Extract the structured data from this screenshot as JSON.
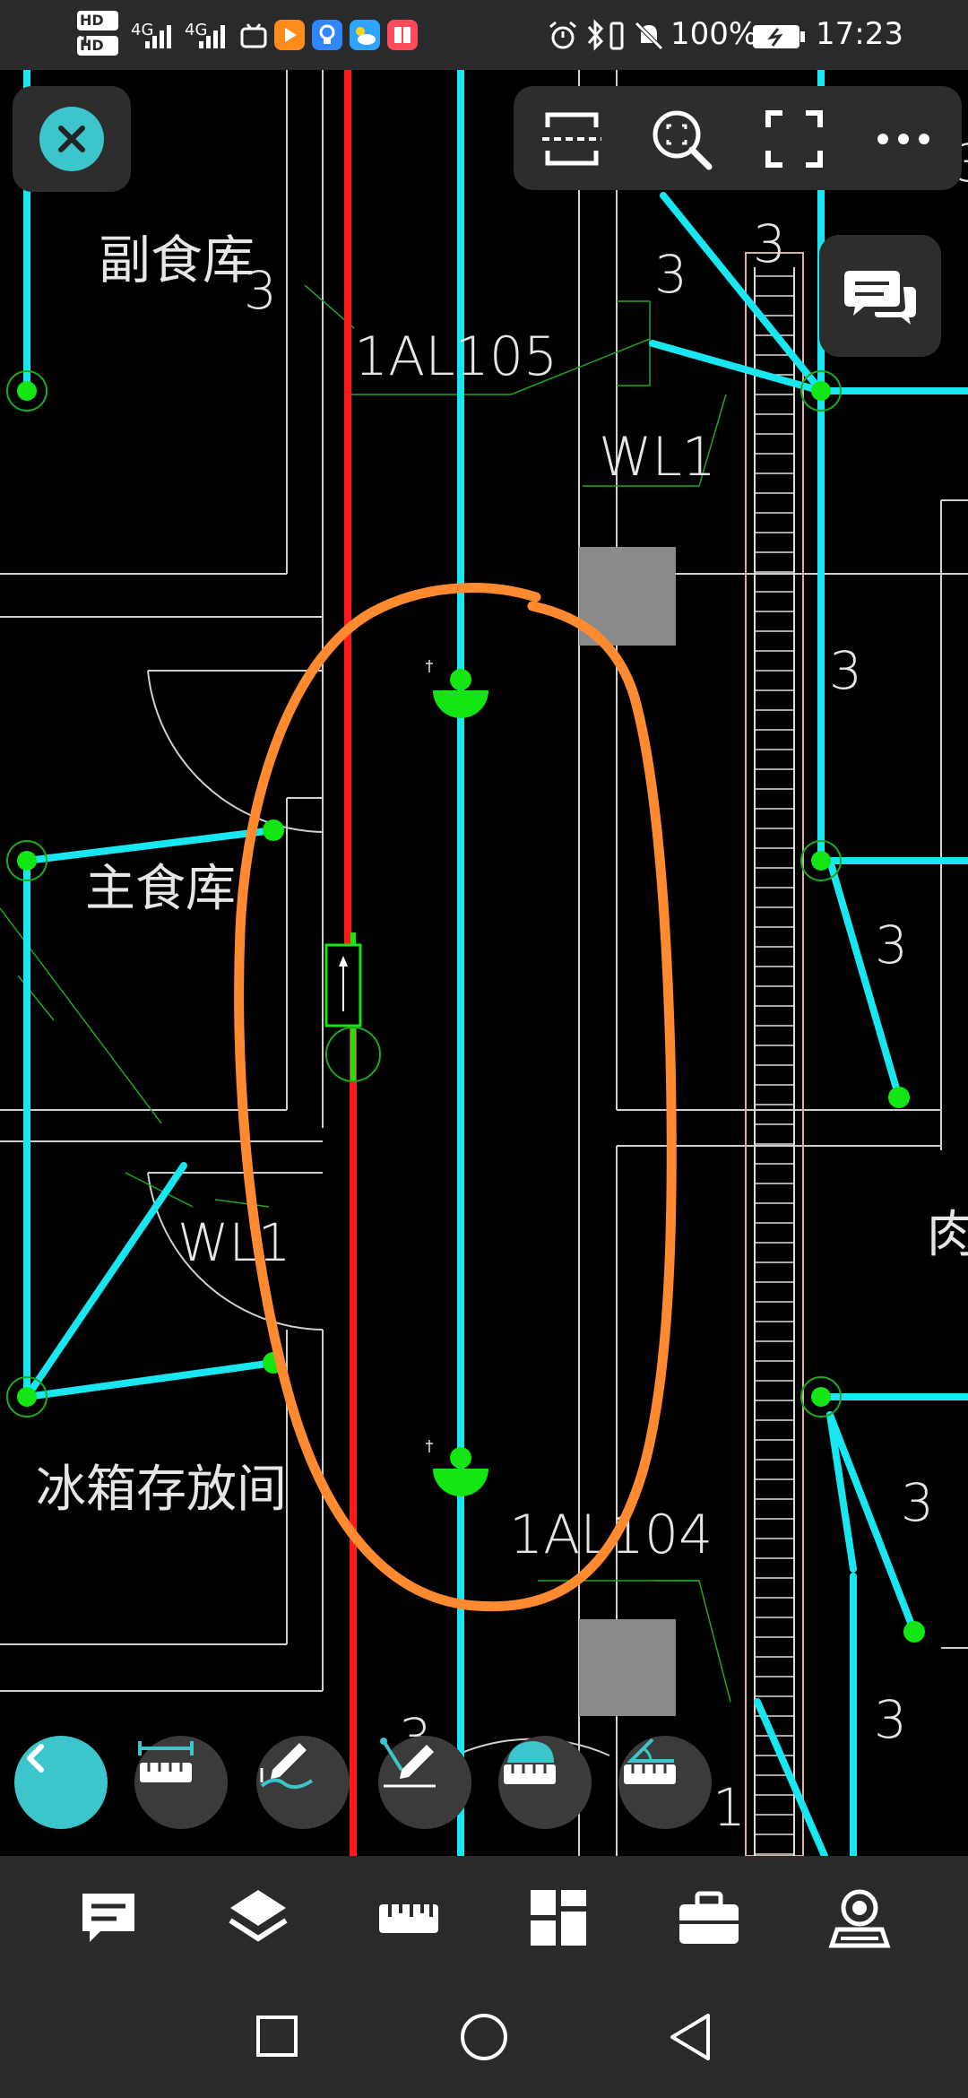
{
  "status_bar": {
    "sim_labels": [
      "HD 1",
      "HD 2"
    ],
    "network": [
      "4G",
      "4G"
    ],
    "battery_percent": "100%",
    "time": "17:23",
    "icons": [
      "bilibili-icon",
      "play-app-icon",
      "bulb-app-icon",
      "weather-icon",
      "book-app-icon",
      "alarm-icon",
      "bluetooth-icon",
      "vibrate-icon",
      "mute-icon",
      "battery-icon"
    ]
  },
  "drawing": {
    "room_labels": {
      "side_food_store": "副食库",
      "main_food_store": "主食库",
      "fridge_room": "冰箱存放间",
      "meat_partial": "肉"
    },
    "circuit_labels": {
      "panel_1al105": "1AL105",
      "panel_1al104": "1AL104",
      "wl1_top": "WL1",
      "wl1_left": "WL1",
      "wl1_bottom_partial": "1"
    },
    "wire_counts": [
      "3",
      "3",
      "3",
      "3",
      "3",
      "3",
      "3",
      "3",
      "3"
    ],
    "colors": {
      "cyan_wire": "#18e6f0",
      "red_wire": "#ff1a1a",
      "green_fixture": "#14e614",
      "annotation_orange": "#ff8a30",
      "wall_line": "#cfcfcf",
      "column_fill": "#8a8a8a"
    }
  },
  "top_toolbar": {
    "close": "close-icon",
    "actions": [
      "frame-select-icon",
      "zoom-region-icon",
      "fullscreen-icon",
      "more-icon"
    ],
    "comment": "comment-bubble-icon"
  },
  "measure_toolbar": {
    "tools": [
      "back-icon",
      "linear-measure-icon",
      "markup-pen-icon",
      "annotation-pen-icon",
      "area-measure-icon",
      "angle-measure-icon"
    ]
  },
  "bottom_nav": {
    "items": [
      "comment-icon",
      "layers-icon",
      "ruler-icon",
      "components-icon",
      "toolbox-icon",
      "viewpoint-icon"
    ]
  },
  "system_nav": {
    "items": [
      "recents-icon",
      "home-icon",
      "back-nav-icon"
    ]
  }
}
